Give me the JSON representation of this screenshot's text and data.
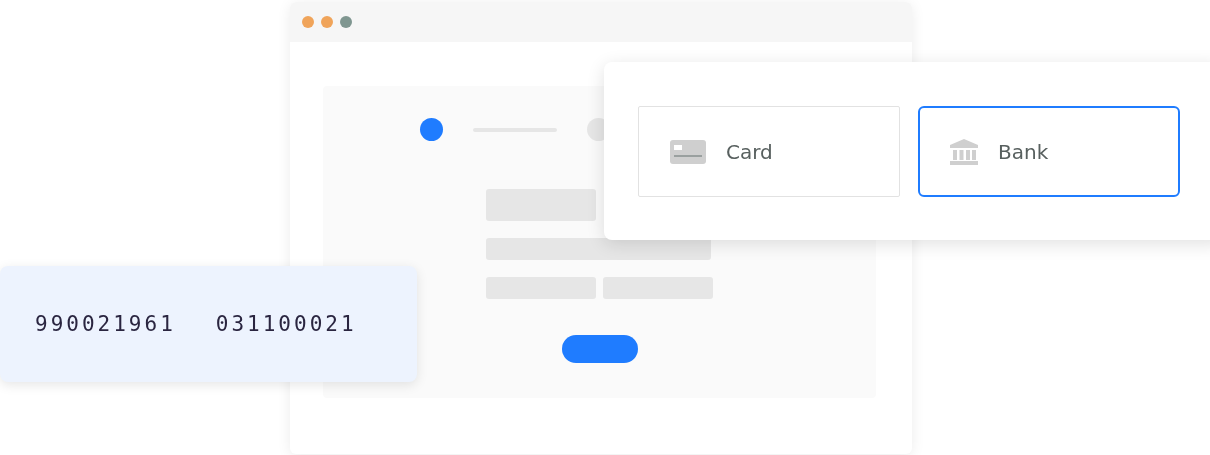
{
  "stepper": [
    {
      "selected": true
    },
    {
      "selected": false
    }
  ],
  "payment_options": [
    {
      "kind": "card",
      "label": "Card",
      "selected": false
    },
    {
      "kind": "bank",
      "label": "Bank",
      "selected": true
    }
  ],
  "check": {
    "micr_line": [
      "990021961",
      "031100021"
    ]
  }
}
